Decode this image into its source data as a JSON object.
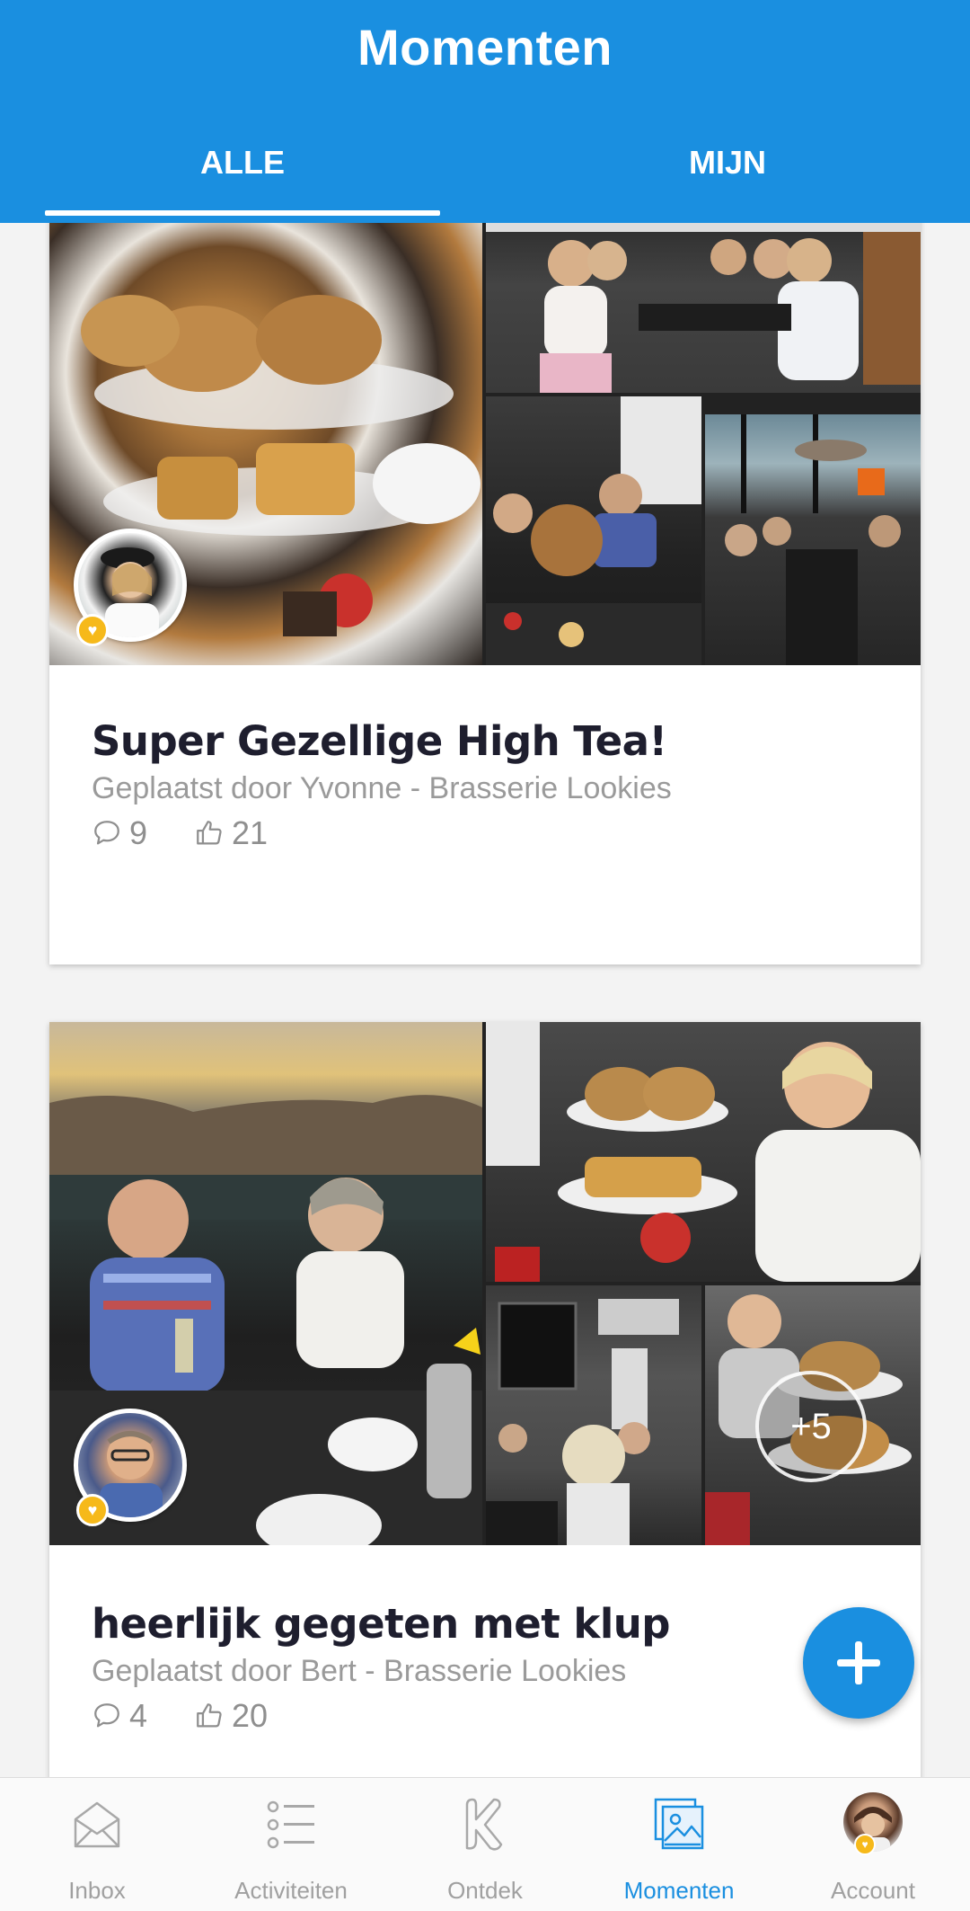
{
  "header": {
    "title": "Momenten",
    "tabs": [
      {
        "label": "ALLE",
        "active": true
      },
      {
        "label": "MIJN",
        "active": false
      }
    ]
  },
  "posts": [
    {
      "title": "Super Gezellige High Tea!",
      "meta": "Geplaatst door Yvonne - Brasserie Lookies",
      "comments": "9",
      "likes": "21"
    },
    {
      "title": "heerlijk gegeten met klup",
      "meta": "Geplaatst door Bert - Brasserie Lookies",
      "comments": "4",
      "likes": "20",
      "more_photos": "+5"
    }
  ],
  "nav": {
    "items": [
      {
        "label": "Inbox",
        "icon": "inbox-icon"
      },
      {
        "label": "Activiteiten",
        "icon": "list-icon"
      },
      {
        "label": "Ontdek",
        "icon": "k-logo-icon"
      },
      {
        "label": "Momenten",
        "icon": "photos-icon",
        "active": true
      },
      {
        "label": "Account",
        "icon": "avatar"
      }
    ]
  },
  "colors": {
    "primary": "#1a8fe0",
    "badge": "#f6b91a",
    "title_text": "#1e1e2e",
    "meta_text": "#9a9a9a"
  }
}
